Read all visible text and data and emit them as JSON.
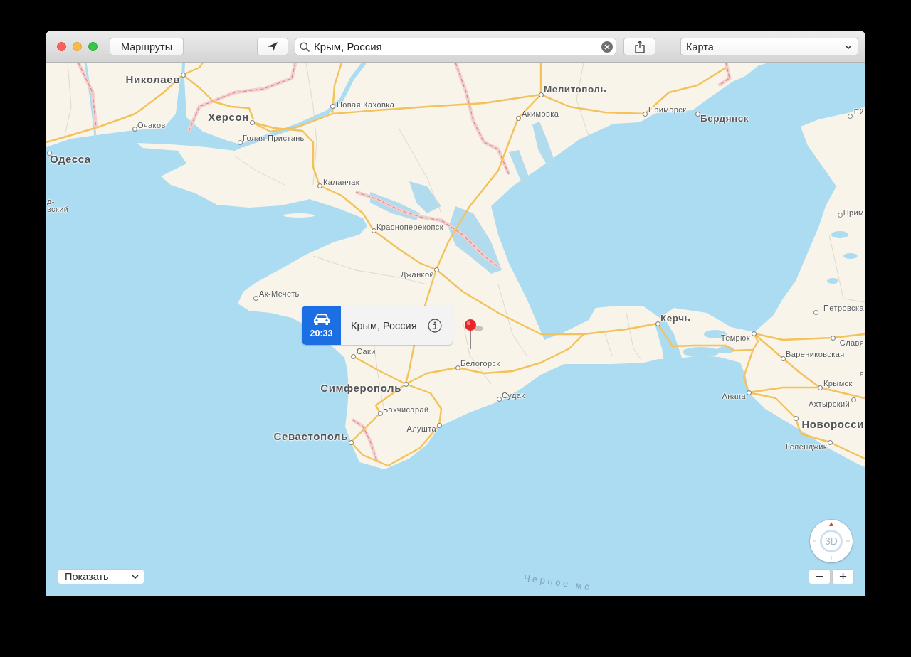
{
  "window": {
    "buttons": [
      {
        "kind": "close"
      },
      {
        "kind": "minimize"
      },
      {
        "kind": "zoom"
      }
    ]
  },
  "toolbar": {
    "routes_button": "Маршруты",
    "search": {
      "value": "Крым, Россия"
    },
    "map_type": "Карта"
  },
  "map": {
    "labels": [
      {
        "text": "Николаев",
        "kind": "major"
      },
      {
        "text": "Мелитополь",
        "kind": "medium"
      },
      {
        "text": "Новая Каховка",
        "kind": "minor"
      },
      {
        "text": "Акимовка",
        "kind": "minor"
      },
      {
        "text": "Приморск",
        "kind": "minor"
      },
      {
        "text": "Ей",
        "kind": "minor"
      },
      {
        "text": "Херсон",
        "kind": "major"
      },
      {
        "text": "Бердянск",
        "kind": "medium"
      },
      {
        "text": "Очаков",
        "kind": "minor"
      },
      {
        "text": "Голая Пристань",
        "kind": "minor"
      },
      {
        "text": "Одесса",
        "kind": "major"
      },
      {
        "text": "Каланчак",
        "kind": "minor"
      },
      {
        "text": "д-",
        "kind": "minor"
      },
      {
        "text": "вский",
        "kind": "minor"
      },
      {
        "text": "Прим",
        "kind": "minor"
      },
      {
        "text": "Красноперекопск",
        "kind": "minor"
      },
      {
        "text": "Джанкой",
        "kind": "minor"
      },
      {
        "text": "Ак-Мечеть",
        "kind": "minor"
      },
      {
        "text": "Петровска",
        "kind": "minor"
      },
      {
        "text": "Керчь",
        "kind": "medium"
      },
      {
        "text": "Темрюк",
        "kind": "minor"
      },
      {
        "text": "Славя",
        "kind": "minor"
      },
      {
        "text": "Саки",
        "kind": "minor"
      },
      {
        "text": "Варениковская",
        "kind": "minor"
      },
      {
        "text": "Белогорск",
        "kind": "minor"
      },
      {
        "text": "я",
        "kind": "minor"
      },
      {
        "text": "Крымск",
        "kind": "minor"
      },
      {
        "text": "Симферополь",
        "kind": "major"
      },
      {
        "text": "Судак",
        "kind": "minor"
      },
      {
        "text": "Анапа",
        "kind": "minor"
      },
      {
        "text": "Ахтырский",
        "kind": "minor"
      },
      {
        "text": "Бахчисарай",
        "kind": "minor"
      },
      {
        "text": "Новоросси",
        "kind": "major"
      },
      {
        "text": "Алушта",
        "kind": "minor"
      },
      {
        "text": "Севастополь",
        "kind": "major"
      },
      {
        "text": "Геленджик",
        "kind": "minor"
      },
      {
        "text": "Черное мо",
        "kind": "sea"
      }
    ],
    "callout": {
      "eta": "20:33",
      "title": "Крым, Россия"
    },
    "show_menu": "Показать",
    "compass": "3D",
    "zoom_buttons": [
      "−",
      "+"
    ]
  }
}
